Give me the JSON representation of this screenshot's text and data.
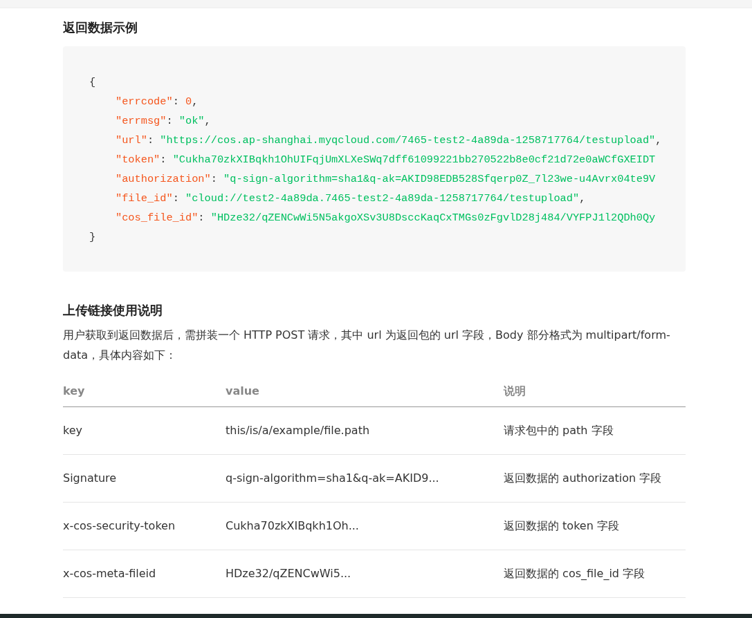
{
  "response_example": {
    "title": "返回数据示例",
    "code_lines": [
      [
        {
          "kind": "punct",
          "text": "{"
        }
      ],
      [
        {
          "kind": "key",
          "text": "\"errcode\""
        },
        {
          "kind": "punct",
          "text": ": "
        },
        {
          "kind": "number",
          "text": "0"
        },
        {
          "kind": "punct",
          "text": ","
        }
      ],
      [
        {
          "kind": "key",
          "text": "\"errmsg\""
        },
        {
          "kind": "punct",
          "text": ": "
        },
        {
          "kind": "string",
          "text": "\"ok\""
        },
        {
          "kind": "punct",
          "text": ","
        }
      ],
      [
        {
          "kind": "key",
          "text": "\"url\""
        },
        {
          "kind": "punct",
          "text": ": "
        },
        {
          "kind": "string",
          "text": "\"https://cos.ap-shanghai.myqcloud.com/7465-test2-4a89da-1258717764/testupload\""
        },
        {
          "kind": "punct",
          "text": ","
        }
      ],
      [
        {
          "kind": "key",
          "text": "\"token\""
        },
        {
          "kind": "punct",
          "text": ": "
        },
        {
          "kind": "string",
          "text": "\"Cukha70zkXIBqkh1OhUIFqjUmXLXeSWq7dff61099221bb270522b8e0cf21d72e0aWCfGXEIDT"
        }
      ],
      [
        {
          "kind": "key",
          "text": "\"authorization\""
        },
        {
          "kind": "punct",
          "text": ": "
        },
        {
          "kind": "string",
          "text": "\"q-sign-algorithm=sha1&q-ak=AKID98EDB528Sfqerp0Z_7l23we-u4Avrx04te9V"
        }
      ],
      [
        {
          "kind": "key",
          "text": "\"file_id\""
        },
        {
          "kind": "punct",
          "text": ": "
        },
        {
          "kind": "string",
          "text": "\"cloud://test2-4a89da.7465-test2-4a89da-1258717764/testupload\""
        },
        {
          "kind": "punct",
          "text": ","
        }
      ],
      [
        {
          "kind": "key",
          "text": "\"cos_file_id\""
        },
        {
          "kind": "punct",
          "text": ": "
        },
        {
          "kind": "string",
          "text": "\"HDze32/qZENCwWi5N5akgoXSv3U8DsccKaqCxTMGs0zFgvlD28j484/VYFPJ1l2QDh0Qy"
        }
      ],
      [
        {
          "kind": "punct",
          "text": "}"
        }
      ]
    ]
  },
  "upload_guide": {
    "title": "上传链接使用说明",
    "description": "用户获取到返回数据后，需拼装一个 HTTP POST 请求，其中 url 为返回包的 url 字段，Body 部分格式为 multipart/form-data，具体内容如下：",
    "table": {
      "columns": [
        "key",
        "value",
        "说明"
      ],
      "rows": [
        [
          "key",
          "this/is/a/example/file.path",
          "请求包中的 path 字段"
        ],
        [
          "Signature",
          "q-sign-algorithm=sha1&q-ak=AKID9...",
          "返回数据的 authorization 字段"
        ],
        [
          "x-cos-security-token",
          "Cukha70zkXIBqkh1Oh...",
          "返回数据的 token 字段"
        ],
        [
          "x-cos-meta-fileid",
          "HDze32/qZENCwWi5...",
          "返回数据的 cos_file_id 字段"
        ]
      ]
    }
  }
}
